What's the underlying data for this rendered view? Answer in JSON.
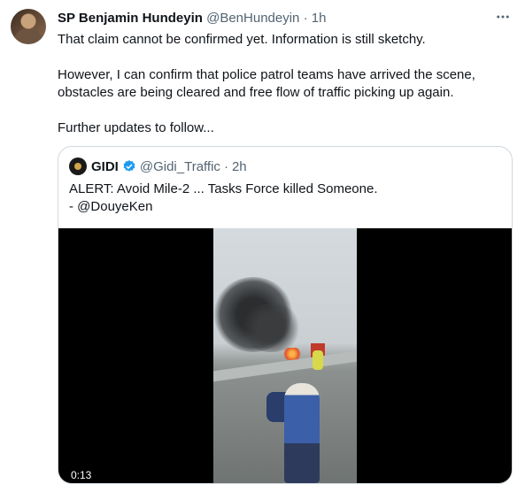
{
  "tweet": {
    "author_name": "SP Benjamin Hundeyin",
    "author_handle": "@BenHundeyin",
    "separator": "·",
    "time": "1h",
    "more_icon": "more-horizontal-icon",
    "paragraphs": [
      "That claim cannot be confirmed yet. Information is still sketchy.",
      "However, I can confirm that police patrol teams have arrived the scene, obstacles are being cleared and free flow of traffic picking up again.",
      "Further updates to follow..."
    ]
  },
  "quoted": {
    "author_name": "GIDI",
    "verified_icon": "verified-badge-icon",
    "author_handle": "@Gidi_Traffic",
    "separator": "·",
    "time": "2h",
    "line1": "ALERT: Avoid Mile-2 ... Tasks Force killed Someone.",
    "line2": "- @DouyeKen",
    "video": {
      "timestamp": "0:13"
    }
  },
  "colors": {
    "verified": "#1d9bf0",
    "secondary_text": "#536471",
    "border": "#cfd9de"
  }
}
